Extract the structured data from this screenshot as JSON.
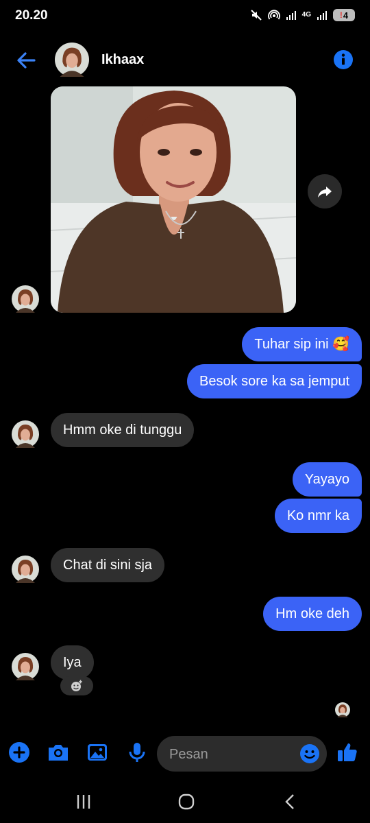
{
  "status_bar": {
    "time": "20.20",
    "network": "4G",
    "battery": "4"
  },
  "header": {
    "name": "Ikhaax"
  },
  "messages": {
    "m1": "Tuhar sip ini 🥰",
    "m2": "Besok sore ka sa jemput",
    "m3": "Hmm oke di tunggu",
    "m4": "Yayayo",
    "m5": "Ko nmr ka",
    "m6": "Chat di sini sja",
    "m7": "Hm oke deh",
    "m8": "Iya"
  },
  "composer": {
    "placeholder": "Pesan"
  },
  "icons": {
    "back": "arrow-left-icon",
    "info": "info-icon",
    "forward": "forward-icon",
    "add": "plus-icon",
    "camera": "camera-icon",
    "gallery": "image-icon",
    "mic": "microphone-icon",
    "emoji": "smile-icon",
    "like": "thumbs-up-icon"
  },
  "colors": {
    "accent": "#3b63f6",
    "incoming": "#2f2f2f",
    "background": "#000000",
    "icon_blue": "#1a73f5"
  }
}
